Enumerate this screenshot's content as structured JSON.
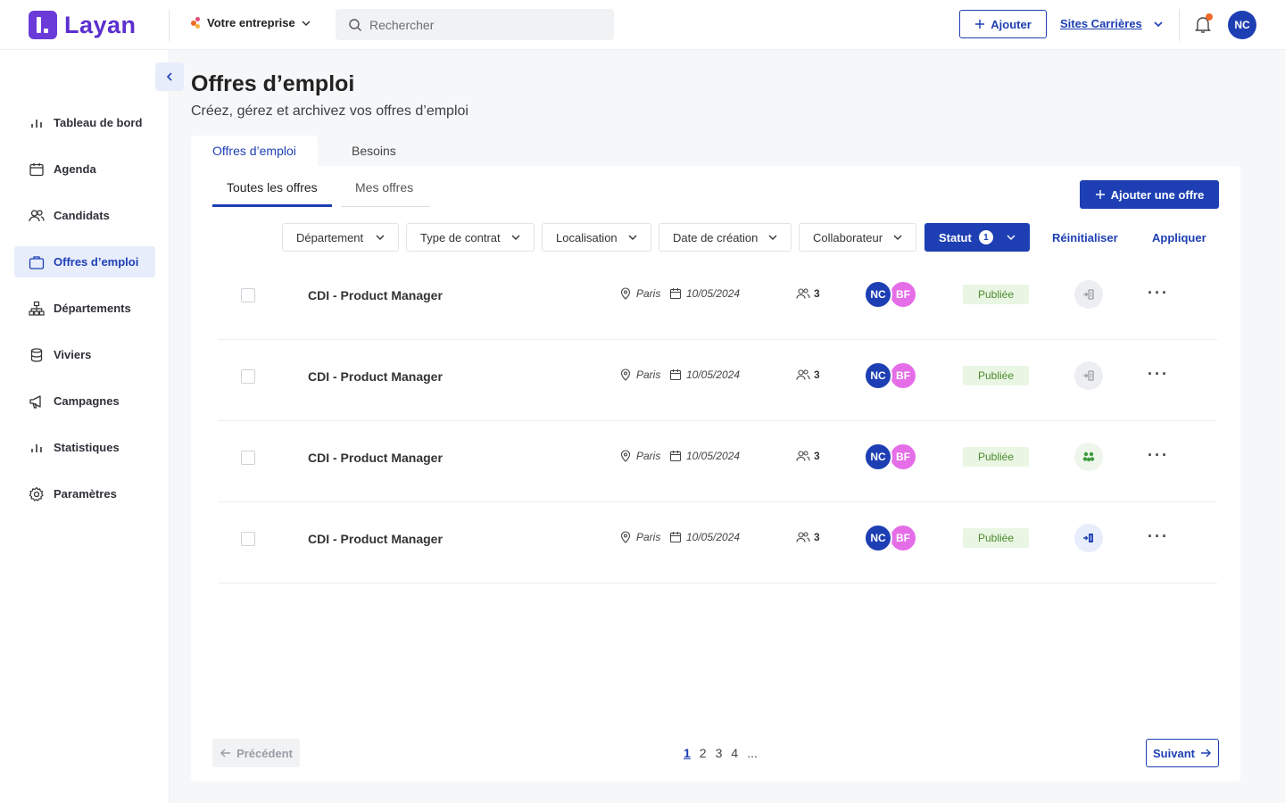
{
  "app": {
    "name": "Layan"
  },
  "header": {
    "company": "Votre entreprise",
    "search_placeholder": "Rechercher",
    "add_label": "Ajouter",
    "sites_label": "Sites Carrières",
    "user_initials": "NC",
    "notification_dot_color": "#ef6a2a"
  },
  "sidebar": {
    "items": [
      {
        "label": "Tableau de bord",
        "icon": "bar-chart-icon"
      },
      {
        "label": "Agenda",
        "icon": "calendar-icon"
      },
      {
        "label": "Candidats",
        "icon": "users-icon"
      },
      {
        "label": "Offres d’emploi",
        "icon": "briefcase-icon",
        "active": true
      },
      {
        "label": "Départements",
        "icon": "org-chart-icon"
      },
      {
        "label": "Viviers",
        "icon": "database-icon"
      },
      {
        "label": "Campagnes",
        "icon": "megaphone-icon"
      },
      {
        "label": "Statistiques",
        "icon": "bar-chart-icon"
      },
      {
        "label": "Paramètres",
        "icon": "gear-icon"
      }
    ]
  },
  "page": {
    "title": "Offres d’emploi",
    "subtitle": "Créez, gérez et archivez vos offres d’emploi",
    "tabs": [
      "Offres d’emploi",
      "Besoins"
    ],
    "subtabs": [
      "Toutes les offres",
      "Mes offres"
    ],
    "add_offer_label": "Ajouter une offre"
  },
  "filters": {
    "items": [
      "Département",
      "Type de contrat",
      "Localisation",
      "Date de création",
      "Collaborateur"
    ],
    "statut_label": "Statut",
    "statut_count": "1",
    "reset_label": "Réinitialiser",
    "apply_label": "Appliquer"
  },
  "offers": [
    {
      "title": "CDI - Product Manager",
      "location": "Paris",
      "date": "10/05/2024",
      "candidates": "3",
      "collab1": "NC",
      "collab2": "BF",
      "status": "Publiée",
      "integration": "grey"
    },
    {
      "title": "CDI - Product Manager",
      "location": "Paris",
      "date": "10/05/2024",
      "candidates": "3",
      "collab1": "NC",
      "collab2": "BF",
      "status": "Publiée",
      "integration": "grey"
    },
    {
      "title": "CDI - Product Manager",
      "location": "Paris",
      "date": "10/05/2024",
      "candidates": "3",
      "collab1": "NC",
      "collab2": "BF",
      "status": "Publiée",
      "integration": "green"
    },
    {
      "title": "CDI - Product Manager",
      "location": "Paris",
      "date": "10/05/2024",
      "candidates": "3",
      "collab1": "NC",
      "collab2": "BF",
      "status": "Publiée",
      "integration": "blue"
    }
  ],
  "pagination": {
    "prev_label": "Précédent",
    "next_label": "Suivant",
    "pages": [
      "1",
      "2",
      "3",
      "4",
      "..."
    ],
    "current": "1"
  },
  "colors": {
    "primary": "#1d3fb3",
    "brand": "#5b2fcf",
    "status_bg": "#eaf6e4",
    "status_text": "#4c8a2e",
    "avatar_secondary": "#e56ee8"
  }
}
